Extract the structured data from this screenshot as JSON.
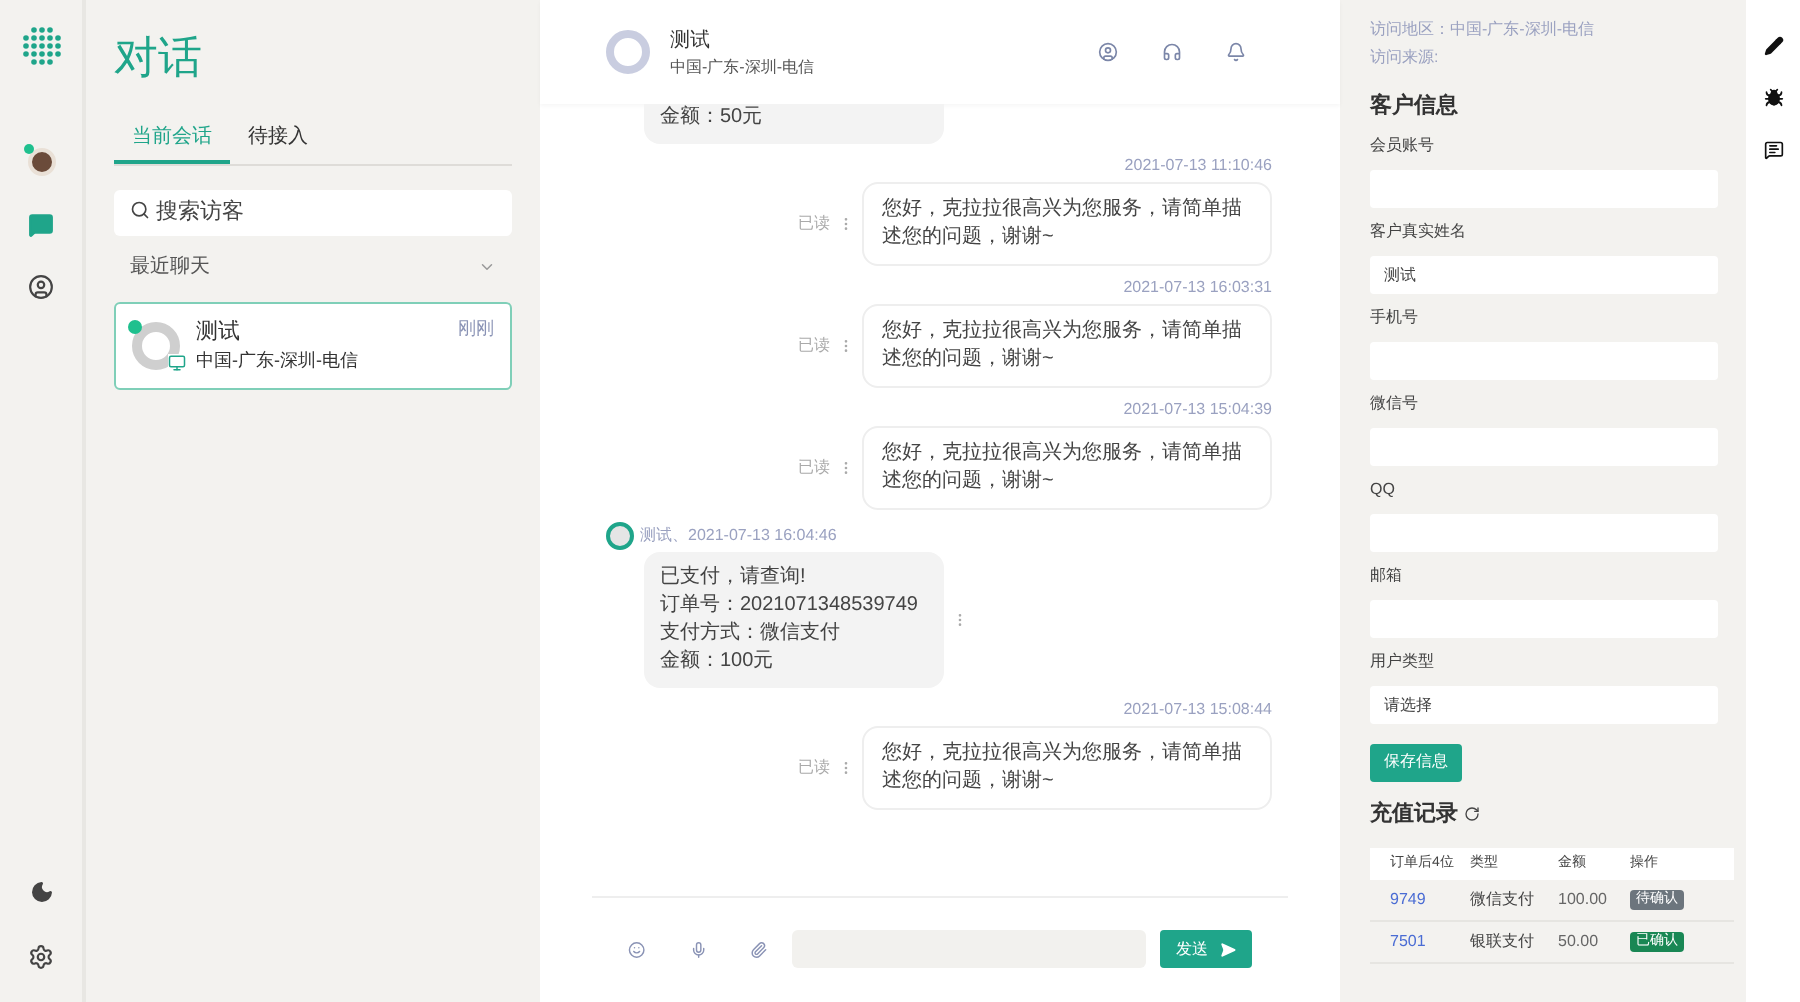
{
  "rail": {
    "avatar_online": true,
    "items": [
      {
        "kind": "chat",
        "selected": true
      },
      {
        "kind": "user",
        "selected": false
      }
    ]
  },
  "conversations": {
    "title": "对话",
    "tabs": [
      {
        "label": "当前会话",
        "selected": true
      },
      {
        "label": "待接入",
        "selected": false
      }
    ],
    "search": {
      "placeholder": "搜索访客"
    },
    "section": "最近聊天",
    "items": [
      {
        "name": "测试",
        "location": "中国-广东-深圳-电信",
        "time": "刚刚",
        "online": true,
        "selected": true
      }
    ]
  },
  "chat": {
    "name": "测试",
    "location": "中国-广东-深圳-电信",
    "messages": [
      {
        "kind": "visitor",
        "partial": true,
        "lines": [
          "金额：50元"
        ]
      },
      {
        "kind": "agent",
        "time": "2021-07-13 11:10:46",
        "status": "已读",
        "lines": [
          "您好，克拉拉很高兴为您服务，请简单描述您的问题，谢谢~"
        ]
      },
      {
        "kind": "agent",
        "time": "2021-07-13 16:03:31",
        "status": "已读",
        "lines": [
          "您好，克拉拉很高兴为您服务，请简单描述您的问题，谢谢~"
        ]
      },
      {
        "kind": "agent",
        "time": "2021-07-13 15:04:39",
        "status": "已读",
        "lines": [
          "您好，克拉拉很高兴为您服务，请简单描述您的问题，谢谢~"
        ]
      },
      {
        "kind": "visitor",
        "sender": "测试、2021-07-13 16:04:46",
        "lines": [
          "已支付，请查询!",
          "订单号：2021071348539749",
          "支付方式：微信支付",
          "金额：100元"
        ]
      },
      {
        "kind": "agent",
        "time": "2021-07-13 15:08:44",
        "status": "已读",
        "lines": [
          "您好，克拉拉很高兴为您服务，请简单描述您的问题，谢谢~"
        ]
      }
    ],
    "send": "发送"
  },
  "visitor_info": [
    "访问地区：中国-广东-深圳-电信",
    "访问来源:"
  ],
  "customer": {
    "title": "客户信息",
    "fields": [
      {
        "label": "会员账号"
      },
      {
        "label": "客户真实姓名",
        "value": "测试"
      },
      {
        "label": "手机号"
      },
      {
        "label": "微信号"
      },
      {
        "label": "QQ"
      },
      {
        "label": "邮箱"
      },
      {
        "label": "用户类型",
        "placeholder": "请选择"
      }
    ],
    "save": "保存信息"
  },
  "records": {
    "title": "充值记录",
    "columns": [
      "订单后4位",
      "类型",
      "金额",
      "操作"
    ],
    "rows": [
      {
        "order": "9749",
        "type": "微信支付",
        "amount": "100.00",
        "action": "待确认",
        "confirmed": false
      },
      {
        "order": "7501",
        "type": "银联支付",
        "amount": "50.00",
        "action": "已确认",
        "confirmed": true
      }
    ]
  }
}
